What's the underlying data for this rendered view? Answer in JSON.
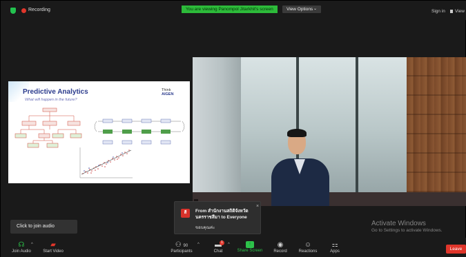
{
  "top_bar": {
    "recording_label": "Recording",
    "viewing_banner": "You are viewing Panompol Jitarkhit's screen",
    "view_options_label": "View Options",
    "view_options_caret": "⌄",
    "sign_in_label": "Sign in",
    "view_label": "View"
  },
  "shared_screen": {
    "slide_title": "Predictive Analytics",
    "slide_subtitle": "What will happen in the future?",
    "logo_line1": "Think",
    "logo_line2": "AIGEN"
  },
  "video": {
    "participant_name": "",
    "accent_colors": {
      "jacket": "#1d2a44",
      "wood": "#8e5a35"
    }
  },
  "chat_popup": {
    "avatar_initial": "สี",
    "from_text": "From สำนักงานสถิติจังหวัดนครราชสีมา to Everyone",
    "message": "ขอบคุณค่ะ",
    "close_icon": "×"
  },
  "watermark": {
    "title": "Activate Windows",
    "subtitle": "Go to Settings to activate Windows."
  },
  "tooltip": {
    "text": "Click to join audio"
  },
  "toolbar": {
    "join_audio_label": "Join Audio",
    "start_video_label": "Start Video",
    "participants_label": "Participants",
    "participants_count": "90",
    "chat_label": "Chat",
    "chat_badge": "1",
    "share_screen_label": "Share Screen",
    "record_label": "Record",
    "reactions_label": "Reactions",
    "apps_label": "Apps",
    "leave_label": "Leave",
    "caret": "^"
  },
  "colors": {
    "accent_green": "#2dbb3a",
    "leave_red": "#e0362b",
    "background": "#1a1a1a"
  }
}
